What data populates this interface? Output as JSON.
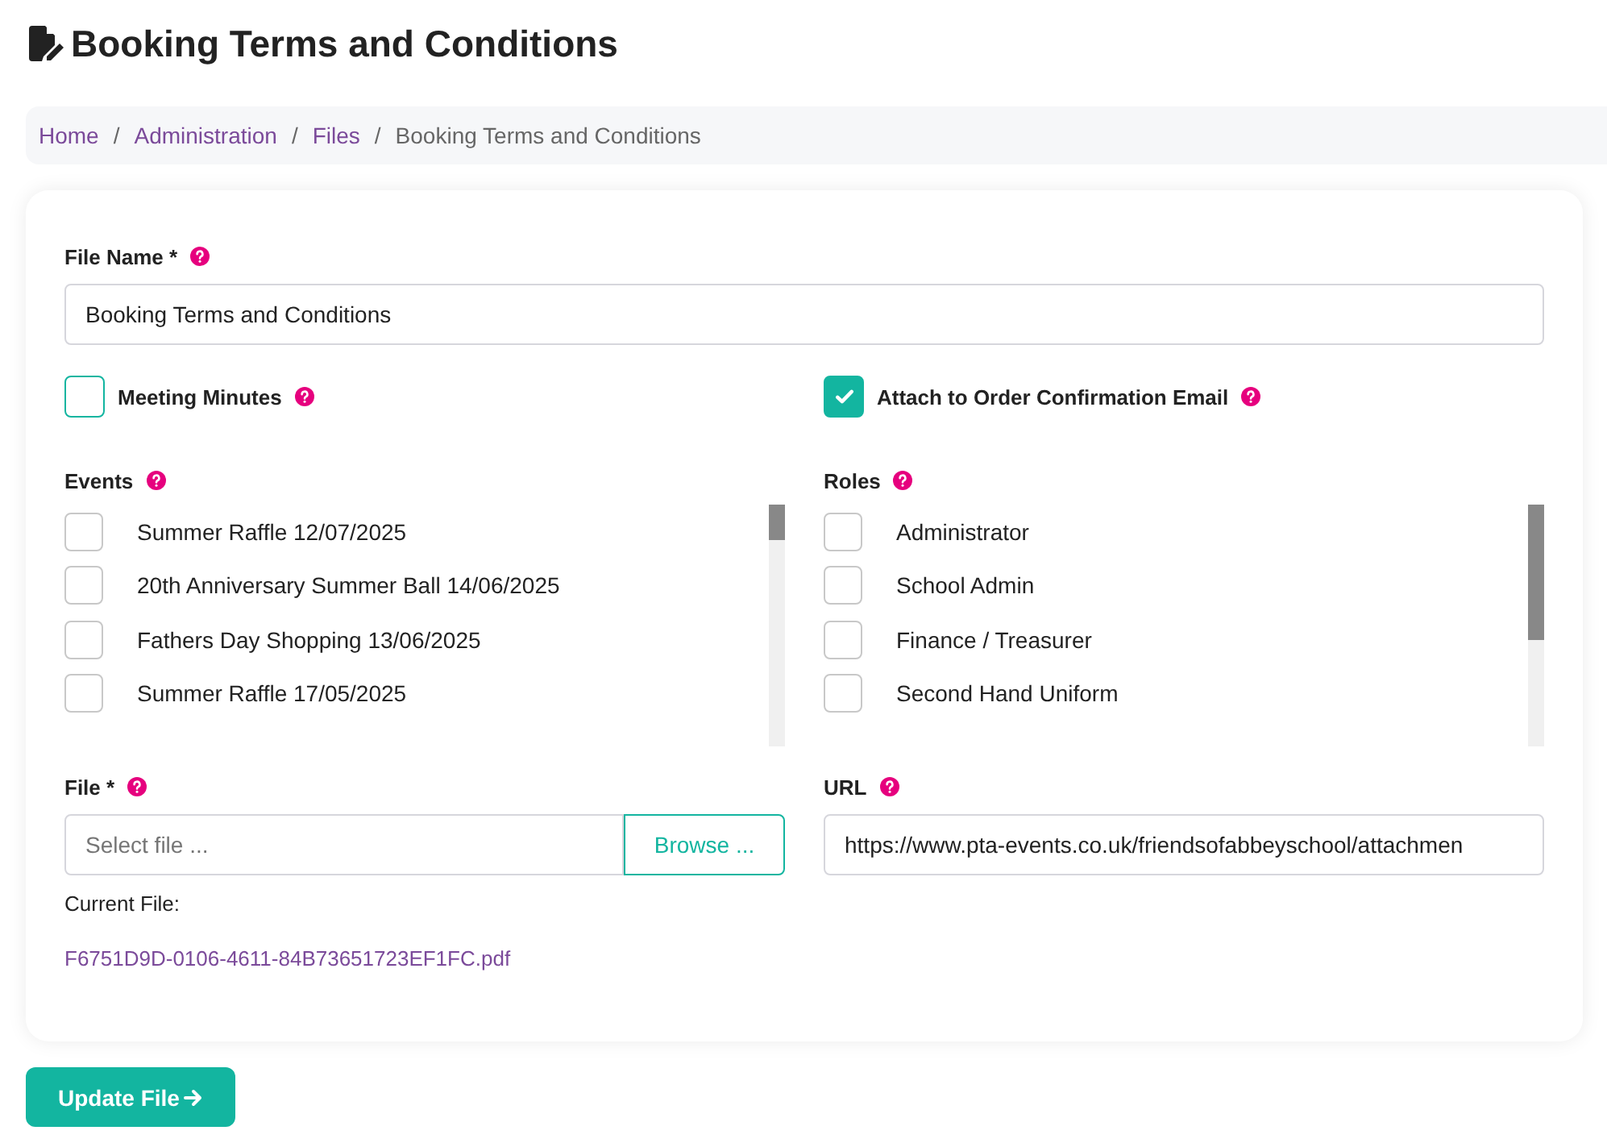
{
  "page_title": "Booking Terms and Conditions",
  "breadcrumb_separator": "/",
  "breadcrumb": [
    {
      "label": "Home",
      "kind": "link"
    },
    {
      "label": "Administration",
      "kind": "link"
    },
    {
      "label": "Files",
      "kind": "link"
    },
    {
      "label": "Booking Terms and Conditions",
      "kind": "current"
    }
  ],
  "file_name": {
    "label": "File Name *",
    "value": "Booking Terms and Conditions"
  },
  "options": [
    {
      "label": "Meeting Minutes",
      "checked": false
    },
    {
      "label": "Attach to Order Confirmation Email",
      "checked": true
    }
  ],
  "lists": [
    {
      "label": "Events",
      "items": [
        {
          "label": "Summer Raffle 12/07/2025",
          "checked": false
        },
        {
          "label": "20th Anniversary Summer Ball 14/06/2025",
          "checked": false
        },
        {
          "label": "Fathers Day Shopping 13/06/2025",
          "checked": false
        },
        {
          "label": "Summer Raffle 17/05/2025",
          "checked": false
        }
      ]
    },
    {
      "label": "Roles",
      "items": [
        {
          "label": "Administrator",
          "checked": false
        },
        {
          "label": "School Admin",
          "checked": false
        },
        {
          "label": "Finance / Treasurer",
          "checked": false
        },
        {
          "label": "Second Hand Uniform",
          "checked": false
        }
      ]
    }
  ],
  "file": {
    "label": "File *",
    "placeholder": "Select file ...",
    "browse": "Browse ...",
    "current_label": "Current File:",
    "current_link": "F6751D9D-0106-4611-84B73651723EF1FC.pdf"
  },
  "url": {
    "label": "URL",
    "value": "https://www.pta-events.co.uk/friendsofabbeyschool/attachmen"
  },
  "submit": "Update File"
}
